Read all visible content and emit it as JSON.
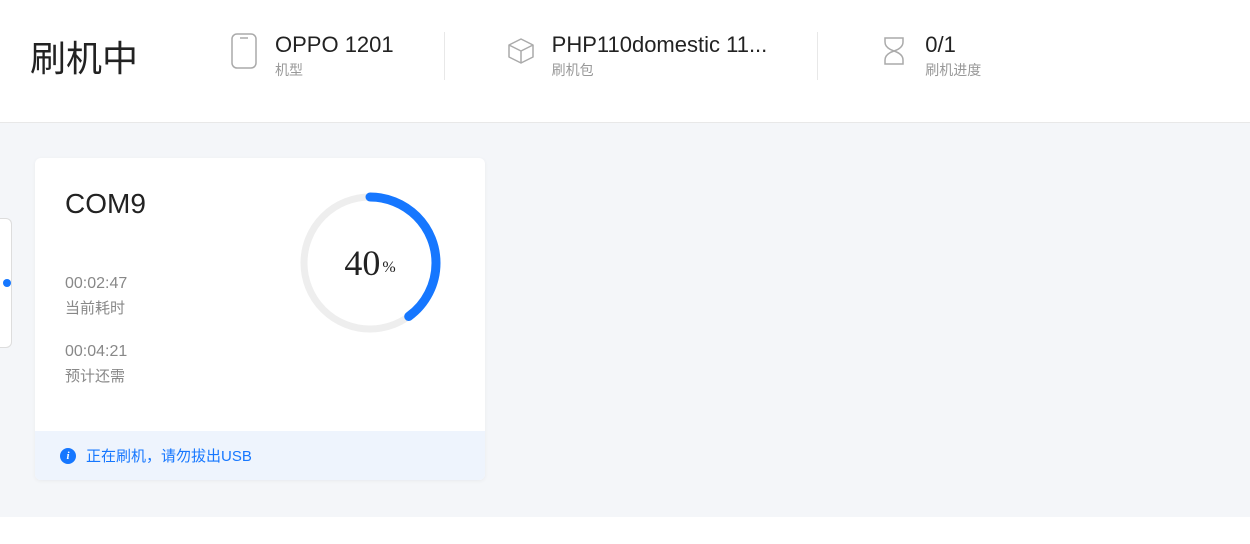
{
  "header": {
    "title": "刷机中",
    "device": {
      "value": "OPPO 1201",
      "label": "机型"
    },
    "package": {
      "value": "PHP110domestic 11...",
      "label": "刷机包"
    },
    "progress": {
      "value": "0/1",
      "label": "刷机进度"
    }
  },
  "card": {
    "port": "COM9",
    "elapsed": {
      "value": "00:02:47",
      "label": "当前耗时"
    },
    "remaining": {
      "value": "00:04:21",
      "label": "预计还需"
    },
    "percent": "40",
    "percent_suffix": "%",
    "status": "正在刷机，请勿拔出USB"
  },
  "colors": {
    "accent": "#1677ff"
  }
}
